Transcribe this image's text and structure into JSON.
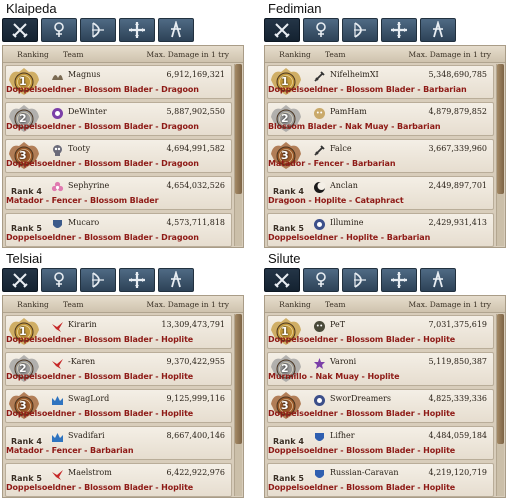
{
  "servers": [
    {
      "name": "Klaipeda",
      "headers": {
        "ranking": "Ranking",
        "team": "Team",
        "damage": "Max. Damage in 1 try"
      },
      "rows": [
        {
          "rank": "1",
          "name": "Magnus",
          "damage": "6,912,169,321",
          "classes": "Doppelsoeldner - Blossom Blader - Dragoon",
          "emblem": "wing-emblem",
          "emblem_color": "#7a6a52"
        },
        {
          "rank": "2",
          "name": "DeWinter",
          "damage": "5,887,902,550",
          "classes": "Doppelsoeldner - Blossom Blader - Dragoon",
          "emblem": "circle-emblem",
          "emblem_color": "#7b3fa8"
        },
        {
          "rank": "3",
          "name": "Tooty",
          "damage": "4,694,991,582",
          "classes": "Doppelsoeldner - Blossom Blader - Dragoon",
          "emblem": "skull-emblem",
          "emblem_color": "#6b6b7a"
        },
        {
          "rank": "Rank 4",
          "name": "Sephyrine",
          "damage": "4,654,032,526",
          "classes": "Matador - Fencer - Blossom Blader",
          "emblem": "flower-emblem",
          "emblem_color": "#e07ab0"
        },
        {
          "rank": "Rank 5",
          "name": "Mucaro",
          "damage": "4,573,711,818",
          "classes": "Doppelsoeldner - Blossom Blader - Dragoon",
          "emblem": "crest-emblem",
          "emblem_color": "#3c5a8a"
        }
      ]
    },
    {
      "name": "Fedimian",
      "headers": {
        "ranking": "Ranking",
        "team": "Team",
        "damage": "Max. Damage in 1 try"
      },
      "rows": [
        {
          "rank": "1",
          "name": "NifelheimXI",
          "damage": "5,348,690,785",
          "classes": "Doppelsoeldner - Blossom Blader - Barbarian",
          "emblem": "sword-emblem",
          "emblem_color": "#333333"
        },
        {
          "rank": "2",
          "name": "PamHam",
          "damage": "4,879,879,852",
          "classes": "Blossom Blader - Nak Muay - Barbarian",
          "emblem": "face-emblem",
          "emblem_color": "#c9a96a"
        },
        {
          "rank": "3",
          "name": "Falce",
          "damage": "3,667,339,960",
          "classes": "Matador - Fencer - Barbarian",
          "emblem": "sword-emblem",
          "emblem_color": "#333333"
        },
        {
          "rank": "Rank 4",
          "name": "Anclan",
          "damage": "2,449,897,701",
          "classes": "Dragoon - Hoplite - Cataphract",
          "emblem": "moon-emblem",
          "emblem_color": "#1a1a1a"
        },
        {
          "rank": "Rank 5",
          "name": "Illumine",
          "damage": "2,429,931,413",
          "classes": "Doppelsoeldner - Hoplite - Barbarian",
          "emblem": "circle-emblem",
          "emblem_color": "#3c4f8a"
        }
      ]
    },
    {
      "name": "Telsiai",
      "headers": {
        "ranking": "Ranking",
        "team": "Team",
        "damage": "Max. Damage in 1 try"
      },
      "rows": [
        {
          "rank": "1",
          "name": "Kirarin",
          "damage": "13,309,473,791",
          "classes": "Doppelsoeldner - Blossom Blader - Hoplite",
          "emblem": "bird-emblem",
          "emblem_color": "#c62828"
        },
        {
          "rank": "2",
          "name": "-Karen",
          "damage": "9,370,422,955",
          "classes": "Doppelsoeldner - Blossom Blader - Hoplite",
          "emblem": "bird-emblem",
          "emblem_color": "#c62828"
        },
        {
          "rank": "3",
          "name": "SwagLord",
          "damage": "9,125,999,116",
          "classes": "Doppelsoeldner - Blossom Blader - Hoplite",
          "emblem": "crown-emblem",
          "emblem_color": "#2f74c0"
        },
        {
          "rank": "Rank 4",
          "name": "Svadifari",
          "damage": "8,667,400,146",
          "classes": "Matador - Fencer - Barbarian",
          "emblem": "crown-emblem",
          "emblem_color": "#2f74c0"
        },
        {
          "rank": "Rank 5",
          "name": "Maelstrom",
          "damage": "6,422,922,976",
          "classes": "Doppelsoeldner - Blossom Blader - Hoplite",
          "emblem": "bird-emblem",
          "emblem_color": "#c62828"
        }
      ]
    },
    {
      "name": "Silute",
      "headers": {
        "ranking": "Ranking",
        "team": "Team",
        "damage": "Max. Damage in 1 try"
      },
      "rows": [
        {
          "rank": "1",
          "name": "PeT",
          "damage": "7,031,375,619",
          "classes": "Doppelsoeldner - Blossom Blader - Hoplite",
          "emblem": "face-emblem",
          "emblem_color": "#4a4a3a"
        },
        {
          "rank": "2",
          "name": "Varoni",
          "damage": "5,119,850,387",
          "classes": "Murmillo - Nak Muay - Hoplite",
          "emblem": "star-emblem",
          "emblem_color": "#7b3fa8"
        },
        {
          "rank": "3",
          "name": "SworDreamers",
          "damage": "4,825,339,336",
          "classes": "Doppelsoeldner - Blossom Blader - Hoplite",
          "emblem": "circle-emblem",
          "emblem_color": "#3c4f8a"
        },
        {
          "rank": "Rank 4",
          "name": "Lifher",
          "damage": "4,484,059,184",
          "classes": "Doppelsoeldner - Blossom Blader - Hoplite",
          "emblem": "crest-emblem",
          "emblem_color": "#2f5fb0"
        },
        {
          "rank": "Rank 5",
          "name": "Russian-Caravan",
          "damage": "4,219,120,719",
          "classes": "Doppelsoeldner - Blossom Blader - Hoplite",
          "emblem": "crest-emblem",
          "emblem_color": "#2f5fb0"
        }
      ]
    }
  ],
  "class_tabs": [
    {
      "icon": "swords-icon",
      "active": true
    },
    {
      "icon": "wizard-icon",
      "active": false
    },
    {
      "icon": "bow-icon",
      "active": false
    },
    {
      "icon": "cross-icon",
      "active": false
    },
    {
      "icon": "scout-icon",
      "active": false
    }
  ],
  "colors": {
    "medal_gold": "#c49a3c",
    "medal_silver": "#9c9c9c",
    "medal_bronze": "#9c5a2a",
    "class_text": "#8e1a16"
  }
}
